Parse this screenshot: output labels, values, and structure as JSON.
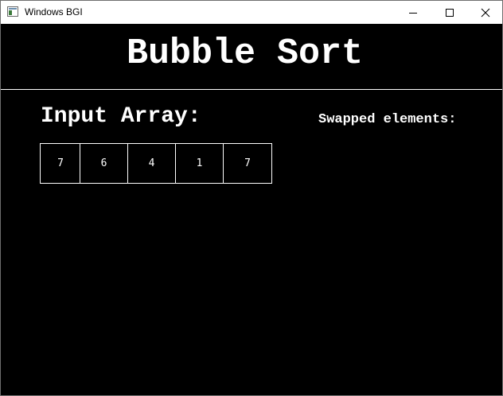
{
  "window": {
    "title": "Windows BGI"
  },
  "canvas": {
    "heading": "Bubble Sort",
    "input_label": "Input Array:",
    "swapped_label": "Swapped elements:",
    "array": [
      "7",
      "6",
      "4",
      "1",
      "7"
    ]
  }
}
